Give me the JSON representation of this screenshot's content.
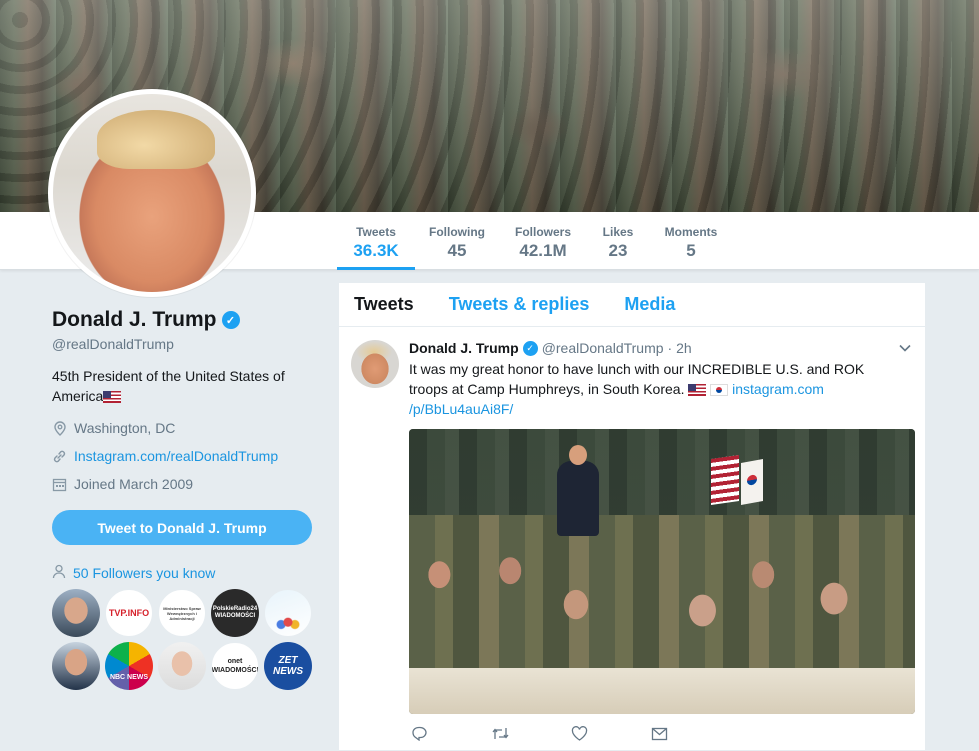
{
  "profile": {
    "name": "Donald J. Trump",
    "handle": "@realDonaldTrump",
    "bio": "45th President of the United States of America",
    "location": "Washington, DC",
    "website": "Instagram.com/realDonaldTrump",
    "joined": "Joined March 2009",
    "tweet_to_button": "Tweet to Donald J. Trump",
    "followers_you_know": "50 Followers you know"
  },
  "nav": {
    "stats": [
      {
        "label": "Tweets",
        "value": "36.3K"
      },
      {
        "label": "Following",
        "value": "45"
      },
      {
        "label": "Followers",
        "value": "42.1M"
      },
      {
        "label": "Likes",
        "value": "23"
      },
      {
        "label": "Moments",
        "value": "5"
      }
    ]
  },
  "known_followers": [
    {
      "name": "person-photo-1",
      "text": ""
    },
    {
      "name": "tvp-info",
      "text": "TVP.INFO"
    },
    {
      "name": "ministry-logo",
      "text": "Ministerstwo Spraw Wewnętrznych i Administracji"
    },
    {
      "name": "polskie-radio",
      "text": "PolskieRadio24 WIADOMOŚCI"
    },
    {
      "name": "bird-logo",
      "text": ""
    },
    {
      "name": "person-photo-2",
      "text": ""
    },
    {
      "name": "nbc-news",
      "text": "NBC NEWS"
    },
    {
      "name": "person-photo-3",
      "text": ""
    },
    {
      "name": "onet",
      "text": "onet WIADOMOŚCI"
    },
    {
      "name": "zet-news",
      "text": "ZET NEWS"
    }
  ],
  "timeline": {
    "tabs": [
      "Tweets",
      "Tweets & replies",
      "Media"
    ],
    "tweet": {
      "name": "Donald J. Trump",
      "handle": "@realDonaldTrump",
      "time": "· 2h",
      "text": "It was my great honor to have lunch with our INCREDIBLE U.S. and ROK troops at Camp Humphreys, in South Korea.",
      "link_part1": "instagram.com",
      "link_part2": "/p/BbLu4auAi8F/"
    }
  },
  "colors": {
    "accent": "#1da1f2",
    "link": "#1b95e0",
    "background": "#e6ecf0"
  }
}
